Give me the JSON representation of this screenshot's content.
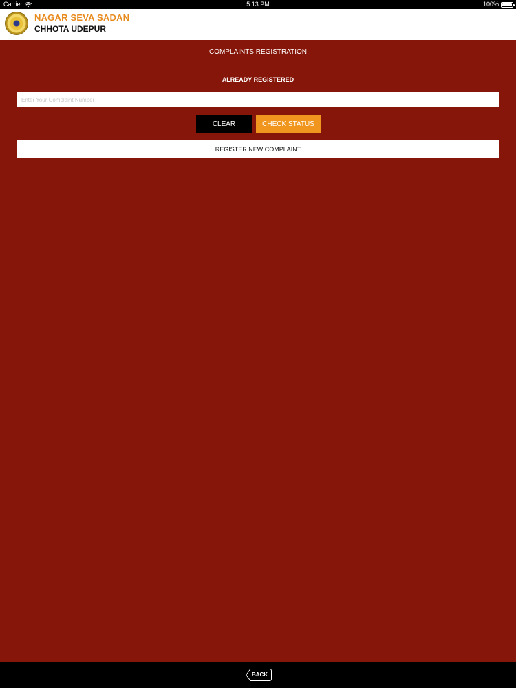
{
  "status_bar": {
    "carrier": "Carrier",
    "time": "5:13 PM",
    "battery": "100%"
  },
  "header": {
    "title": "NAGAR SEVA SADAN",
    "subtitle": "CHHOTA UDEPUR"
  },
  "page": {
    "title": "COMPLAINTS REGISTRATION",
    "section_label": "ALREADY REGISTERED",
    "complaint_input": {
      "placeholder": "Enter Your Complaint Number",
      "value": ""
    },
    "clear_label": "CLEAR",
    "check_status_label": "CHECK STATUS",
    "register_label": "REGISTER NEW COMPLAINT"
  },
  "footer": {
    "back_label": "BACK"
  },
  "colors": {
    "background": "#861609",
    "accent": "#f0951d",
    "header_title": "#e88b1d"
  }
}
